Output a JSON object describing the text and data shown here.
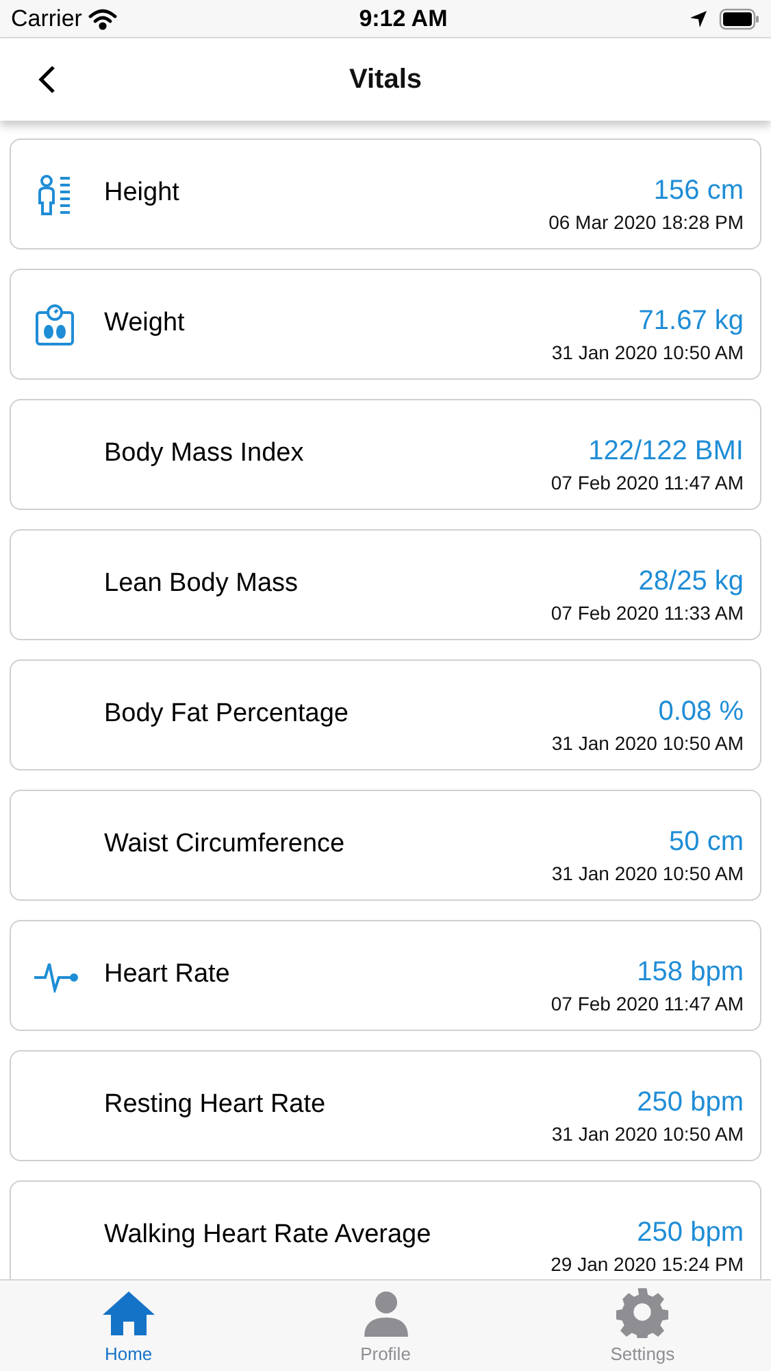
{
  "status_bar": {
    "carrier": "Carrier",
    "time": "9:12 AM"
  },
  "nav": {
    "title": "Vitals"
  },
  "vitals": [
    {
      "kind": "height",
      "name": "Height",
      "value": "156 cm",
      "date": "06 Mar 2020 18:28 PM"
    },
    {
      "kind": "weight",
      "name": "Weight",
      "value": "71.67 kg",
      "date": "31 Jan 2020 10:50 AM"
    },
    {
      "kind": "plain",
      "name": "Body Mass Index",
      "value": "122/122 BMI",
      "date": "07 Feb 2020 11:47 AM"
    },
    {
      "kind": "plain",
      "name": "Lean Body Mass",
      "value": "28/25 kg",
      "date": "07 Feb 2020 11:33 AM"
    },
    {
      "kind": "plain",
      "name": "Body Fat Percentage",
      "value": "0.08 %",
      "date": "31 Jan 2020 10:50 AM"
    },
    {
      "kind": "plain",
      "name": "Waist Circumference",
      "value": "50 cm",
      "date": "31 Jan 2020 10:50 AM"
    },
    {
      "kind": "heart",
      "name": "Heart Rate",
      "value": "158 bpm",
      "date": "07 Feb 2020 11:47 AM"
    },
    {
      "kind": "plain",
      "name": "Resting Heart Rate",
      "value": "250 bpm",
      "date": "31 Jan 2020 10:50 AM"
    },
    {
      "kind": "plain",
      "name": "Walking Heart Rate Average",
      "value": "250 bpm",
      "date": "29 Jan 2020 15:24 PM"
    }
  ],
  "tabs": [
    {
      "kind": "home",
      "label": "Home",
      "selected": true
    },
    {
      "kind": "profile",
      "label": "Profile",
      "selected": false
    },
    {
      "kind": "settings",
      "label": "Settings",
      "selected": false
    }
  ]
}
